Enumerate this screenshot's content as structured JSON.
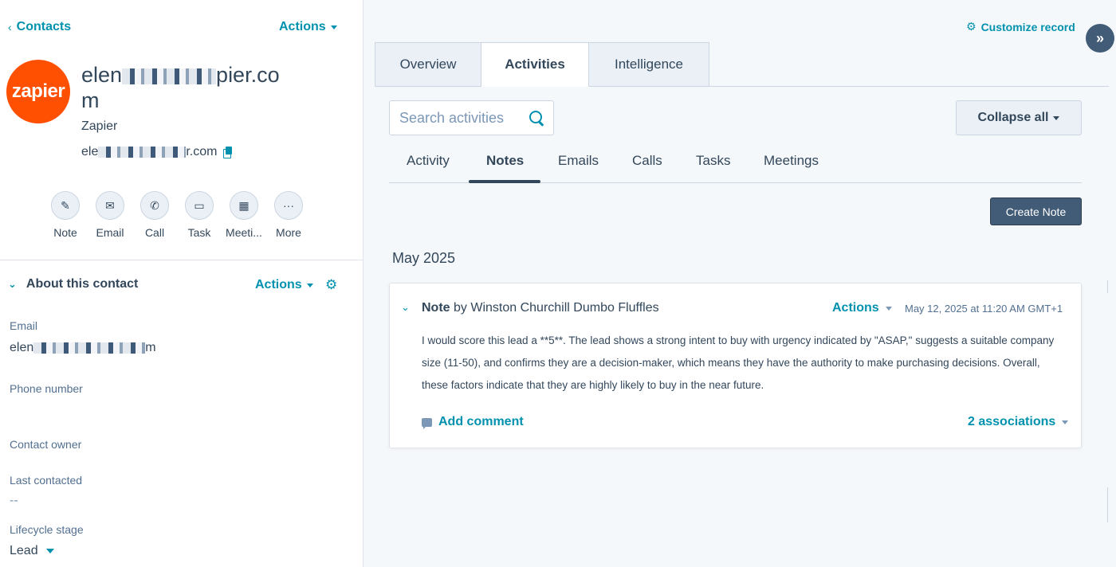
{
  "sidebar": {
    "back_label": "Contacts",
    "actions_label": "Actions",
    "logo_text": "zapier",
    "name_prefix": "elen",
    "name_suffix": "pier.co",
    "name_line2": "m",
    "company": "Zapier",
    "email_prefix": "ele",
    "email_suffix": "r.com",
    "quick_actions": [
      {
        "label": "Note",
        "icon": "edit-icon"
      },
      {
        "label": "Email",
        "icon": "envelope-icon"
      },
      {
        "label": "Call",
        "icon": "phone-icon"
      },
      {
        "label": "Task",
        "icon": "task-icon"
      },
      {
        "label": "Meeti...",
        "icon": "calendar-icon"
      },
      {
        "label": "More",
        "icon": "more-icon"
      }
    ],
    "about": {
      "title": "About this contact",
      "actions_label": "Actions",
      "fields": {
        "email_label": "Email",
        "email_value_prefix": "elen",
        "email_value_suffix": "m",
        "phone_label": "Phone number",
        "owner_label": "Contact owner",
        "last_contacted_label": "Last contacted",
        "last_contacted_value": "--",
        "lifecycle_label": "Lifecycle stage",
        "lifecycle_value": "Lead"
      }
    }
  },
  "main": {
    "customize_label": "Customize record",
    "tabs": [
      {
        "label": "Overview"
      },
      {
        "label": "Activities"
      },
      {
        "label": "Intelligence"
      }
    ],
    "search": {
      "placeholder": "Search activities"
    },
    "collapse_label": "Collapse all",
    "subtabs": [
      {
        "label": "Activity"
      },
      {
        "label": "Notes"
      },
      {
        "label": "Emails"
      },
      {
        "label": "Calls"
      },
      {
        "label": "Tasks"
      },
      {
        "label": "Meetings"
      }
    ],
    "create_note_label": "Create Note",
    "month": "May 2025",
    "note": {
      "type": "Note",
      "by_text": "by Winston Churchill Dumbo Fluffles",
      "actions_label": "Actions",
      "date": "May 12, 2025 at 11:20 AM GMT+1",
      "body": "I would score this lead a **5**. The lead shows a strong intent to buy with urgency indicated by \"ASAP,\" suggests a suitable company size (11-50), and confirms they are a decision-maker, which means they have the authority to make purchasing decisions. Overall, these factors indicate that they are highly likely to buy in the near future.",
      "add_comment_label": "Add comment",
      "associations_label": "2 associations"
    }
  },
  "colors": {
    "accent": "#0091ae",
    "primary_dark": "#425b76",
    "text": "#33475b",
    "zapier_orange": "#ff4f00"
  }
}
